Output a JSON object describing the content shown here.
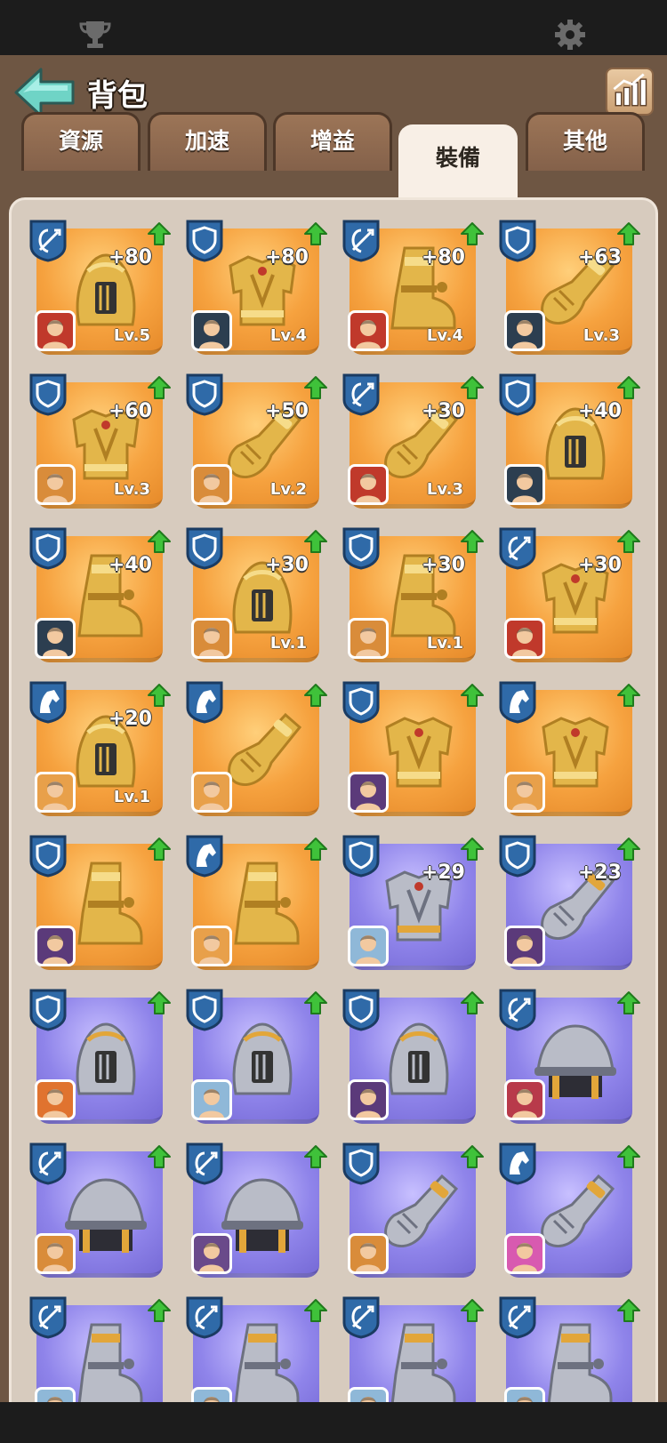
{
  "header": {
    "title": "背包"
  },
  "tabs": [
    {
      "label": "資源"
    },
    {
      "label": "加速"
    },
    {
      "label": "增益"
    },
    {
      "label": "裝備"
    },
    {
      "label": "其他"
    }
  ],
  "active_tab": "裝備",
  "colors": {
    "gold_card": "#f6a23f",
    "purple_card": "#8f84ea",
    "panel": "#d7cbbe",
    "background": "#6e5643",
    "badge_blue": "#2f6aa8",
    "upgrade_green": "#3fc23a"
  },
  "items": [
    {
      "type": "bow",
      "rarity": "gold",
      "icon": "helmet-icon",
      "bonus": "+80",
      "level": "Lv.5",
      "hero": "#c0392b"
    },
    {
      "type": "shield",
      "rarity": "gold",
      "icon": "armor-icon",
      "bonus": "+80",
      "level": "Lv.4",
      "hero": "#2c3e50"
    },
    {
      "type": "bow",
      "rarity": "gold",
      "icon": "boot-icon",
      "bonus": "+80",
      "level": "Lv.4",
      "hero": "#c0392b"
    },
    {
      "type": "shield",
      "rarity": "gold",
      "icon": "gauntlet-icon",
      "bonus": "+63",
      "level": "Lv.3",
      "hero": "#2c3e50"
    },
    {
      "type": "shield",
      "rarity": "gold",
      "icon": "armor-icon",
      "bonus": "+60",
      "level": "Lv.3",
      "hero": "#d98c3a"
    },
    {
      "type": "shield",
      "rarity": "gold",
      "icon": "gauntlet-icon",
      "bonus": "+50",
      "level": "Lv.2",
      "hero": "#d98c3a"
    },
    {
      "type": "bow",
      "rarity": "gold",
      "icon": "gauntlet-icon",
      "bonus": "+30",
      "level": "Lv.3",
      "hero": "#c0392b"
    },
    {
      "type": "shield",
      "rarity": "gold",
      "icon": "helmet-icon",
      "bonus": "+40",
      "level": "",
      "hero": "#2c3e50"
    },
    {
      "type": "shield",
      "rarity": "gold",
      "icon": "boot-icon",
      "bonus": "+40",
      "level": "",
      "hero": "#2c3e50"
    },
    {
      "type": "shield",
      "rarity": "gold",
      "icon": "helmet-icon",
      "bonus": "+30",
      "level": "Lv.1",
      "hero": "#d98c3a"
    },
    {
      "type": "shield",
      "rarity": "gold",
      "icon": "boot-icon",
      "bonus": "+30",
      "level": "Lv.1",
      "hero": "#d98c3a"
    },
    {
      "type": "bow",
      "rarity": "gold",
      "icon": "armor-icon",
      "bonus": "+30",
      "level": "",
      "hero": "#c0392b"
    },
    {
      "type": "horse",
      "rarity": "gold",
      "icon": "helmet-icon",
      "bonus": "+20",
      "level": "Lv.1",
      "hero": "#e8a04a"
    },
    {
      "type": "horse",
      "rarity": "gold",
      "icon": "gauntlet-icon",
      "bonus": "",
      "level": "",
      "hero": "#e8a04a"
    },
    {
      "type": "shield",
      "rarity": "gold",
      "icon": "armor-icon",
      "bonus": "",
      "level": "",
      "hero": "#5b3a7a"
    },
    {
      "type": "horse",
      "rarity": "gold",
      "icon": "armor-icon",
      "bonus": "",
      "level": "",
      "hero": "#e8a04a"
    },
    {
      "type": "shield",
      "rarity": "gold",
      "icon": "boot-icon",
      "bonus": "",
      "level": "",
      "hero": "#5b3a7a"
    },
    {
      "type": "horse",
      "rarity": "gold",
      "icon": "boot-icon",
      "bonus": "",
      "level": "",
      "hero": "#e8a04a"
    },
    {
      "type": "shield",
      "rarity": "purple",
      "icon": "armor-icon",
      "bonus": "+29",
      "level": "",
      "hero": "#8fb8d8"
    },
    {
      "type": "shield",
      "rarity": "purple",
      "icon": "gauntlet-icon",
      "bonus": "+23",
      "level": "",
      "hero": "#5b3a7a"
    },
    {
      "type": "shield",
      "rarity": "purple",
      "icon": "helmet-icon",
      "bonus": "",
      "level": "",
      "hero": "#e0732f"
    },
    {
      "type": "shield",
      "rarity": "purple",
      "icon": "helmet-icon",
      "bonus": "",
      "level": "",
      "hero": "#8fb8d8"
    },
    {
      "type": "shield",
      "rarity": "purple",
      "icon": "helmet-icon",
      "bonus": "",
      "level": "",
      "hero": "#5b3a7a"
    },
    {
      "type": "bow",
      "rarity": "purple",
      "icon": "kettle-helmet-icon",
      "bonus": "",
      "level": "",
      "hero": "#b83a4a"
    },
    {
      "type": "bow",
      "rarity": "purple",
      "icon": "kettle-helmet-icon",
      "bonus": "",
      "level": "",
      "hero": "#d98c3a"
    },
    {
      "type": "bow",
      "rarity": "purple",
      "icon": "kettle-helmet-icon",
      "bonus": "",
      "level": "",
      "hero": "#6a4a8a"
    },
    {
      "type": "shield",
      "rarity": "purple",
      "icon": "gauntlet-icon",
      "bonus": "",
      "level": "",
      "hero": "#d98c3a"
    },
    {
      "type": "horse",
      "rarity": "purple",
      "icon": "gauntlet-icon",
      "bonus": "",
      "level": "",
      "hero": "#d85ab0"
    },
    {
      "type": "bow",
      "rarity": "purple",
      "icon": "boot-icon",
      "bonus": "",
      "level": "",
      "hero": "#8fb8d8"
    },
    {
      "type": "bow",
      "rarity": "purple",
      "icon": "boot-icon",
      "bonus": "",
      "level": "",
      "hero": "#8fb8d8"
    },
    {
      "type": "bow",
      "rarity": "purple",
      "icon": "boot-icon",
      "bonus": "",
      "level": "",
      "hero": "#8fb8d8"
    },
    {
      "type": "bow",
      "rarity": "purple",
      "icon": "boot-icon",
      "bonus": "",
      "level": "",
      "hero": "#8fb8d8"
    }
  ]
}
